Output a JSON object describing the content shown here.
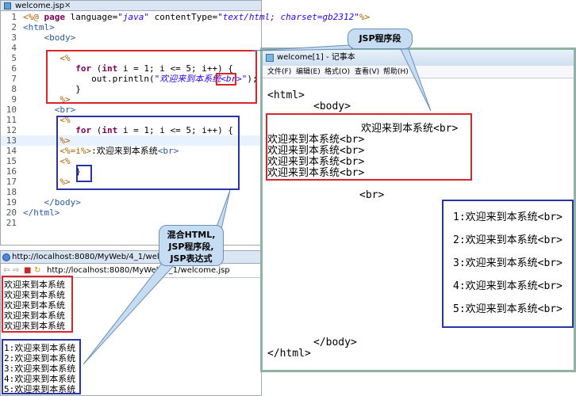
{
  "editor": {
    "tab_title": "welcome.jsp",
    "lines": [
      {
        "n": "1",
        "parts": [
          [
            "jsp",
            "<%@ "
          ],
          [
            "kw",
            "page "
          ],
          [
            "dflt",
            "language="
          ],
          [
            "str",
            "\"java\""
          ],
          [
            "dflt",
            " contentType="
          ],
          [
            "str",
            "\"text/html; charset=gb2312\""
          ],
          [
            "jsp",
            "%>"
          ]
        ]
      },
      {
        "n": "2",
        "parts": [
          [
            "tag",
            "<html>"
          ]
        ]
      },
      {
        "n": "3",
        "parts": [
          [
            "tag",
            "    <body>"
          ]
        ]
      },
      {
        "n": "4",
        "parts": [
          [
            "dflt",
            ""
          ]
        ]
      },
      {
        "n": "5",
        "parts": [
          [
            "jsp",
            "       <%"
          ]
        ]
      },
      {
        "n": "6",
        "parts": [
          [
            "dflt",
            "          "
          ],
          [
            "kw",
            "for"
          ],
          [
            "dflt",
            " ("
          ],
          [
            "kw",
            "int"
          ],
          [
            "dflt",
            " i = 1; i <= 5; i++) {"
          ]
        ]
      },
      {
        "n": "7",
        "parts": [
          [
            "dflt",
            "             out.println("
          ],
          [
            "str",
            "\"欢迎来到本系统<br>\""
          ],
          [
            "dflt",
            ");"
          ]
        ]
      },
      {
        "n": "8",
        "parts": [
          [
            "dflt",
            "          }"
          ]
        ]
      },
      {
        "n": "9",
        "parts": [
          [
            "jsp",
            "       %>"
          ]
        ]
      },
      {
        "n": "10",
        "parts": [
          [
            "tag",
            "      <br>"
          ]
        ]
      },
      {
        "n": "11",
        "parts": [
          [
            "jsp",
            "       <%"
          ]
        ]
      },
      {
        "n": "12",
        "parts": [
          [
            "dflt",
            "          "
          ],
          [
            "kw",
            "for"
          ],
          [
            "dflt",
            " ("
          ],
          [
            "kw",
            "int"
          ],
          [
            "dflt",
            " i = 1; i <= 5; i++) {"
          ]
        ]
      },
      {
        "n": "13",
        "parts": [
          [
            "jsp",
            "       %>"
          ]
        ]
      },
      {
        "n": "14",
        "parts": [
          [
            "jsp",
            "       <%=i%>"
          ],
          [
            "dflt",
            ":欢迎来到本系统"
          ],
          [
            "tag",
            "<br>"
          ]
        ]
      },
      {
        "n": "15",
        "parts": [
          [
            "jsp",
            "       <%"
          ]
        ]
      },
      {
        "n": "16",
        "parts": [
          [
            "dflt",
            "          }"
          ]
        ]
      },
      {
        "n": "17",
        "parts": [
          [
            "jsp",
            "       %>"
          ]
        ]
      },
      {
        "n": "18",
        "parts": [
          [
            "dflt",
            ""
          ]
        ]
      },
      {
        "n": "19",
        "parts": [
          [
            "tag",
            "    </body>"
          ]
        ]
      },
      {
        "n": "20",
        "parts": [
          [
            "tag",
            "</html>"
          ]
        ]
      },
      {
        "n": "21",
        "parts": [
          [
            "dflt",
            ""
          ]
        ]
      }
    ]
  },
  "browser": {
    "tab_title": "http://localhost:8080/MyWeb/4_1/welcome.jsp",
    "address": "http://localhost:8080/MyWeb/4_1/welcome.jsp",
    "first_block": [
      "欢迎来到本系统",
      "欢迎来到本系统",
      "欢迎来到本系统",
      "欢迎来到本系统",
      "欢迎来到本系统"
    ],
    "second_block": [
      "1:欢迎来到本系统",
      "2:欢迎来到本系统",
      "3:欢迎来到本系统",
      "4:欢迎来到本系统",
      "5:欢迎来到本系统"
    ]
  },
  "notepad": {
    "title": "welcome[1] - 记事本",
    "menu": [
      "文件(F)",
      "编辑(E)",
      "格式(O)",
      "查看(V)",
      "帮助(H)"
    ],
    "html_open": "<html>",
    "body_open": "<body>",
    "first_lines": [
      "欢迎来到本系统<br>",
      "欢迎来到本系统<br>",
      "欢迎来到本系统<br>",
      "欢迎来到本系统<br>",
      "欢迎来到本系统<br>"
    ],
    "br": "<br>",
    "second_lines": [
      "1:欢迎来到本系统<br>",
      "2:欢迎来到本系统<br>",
      "3:欢迎来到本系统<br>",
      "4:欢迎来到本系统<br>",
      "5:欢迎来到本系统<br>"
    ],
    "body_close": "</body>",
    "html_close": "</html>"
  },
  "callouts": {
    "jsp_segment": "JSP程序段",
    "mixed": [
      "混合HTML,",
      "JSP程序段,",
      "JSP表达式"
    ]
  },
  "colors": {
    "red_box": "#d9262d",
    "blue_box": "#2834a8",
    "callout_bg": "#c5dcf2"
  }
}
